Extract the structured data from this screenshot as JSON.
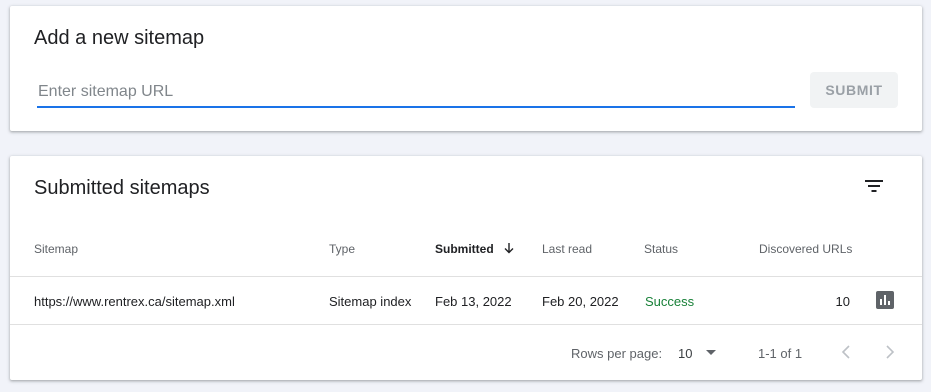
{
  "add_sitemap": {
    "title": "Add a new sitemap",
    "input_placeholder": "Enter sitemap URL",
    "input_value": "",
    "submit_label": "SUBMIT"
  },
  "submitted": {
    "title": "Submitted sitemaps",
    "columns": {
      "sitemap": "Sitemap",
      "type": "Type",
      "submitted": "Submitted",
      "last_read": "Last read",
      "status": "Status",
      "discovered": "Discovered URLs"
    },
    "rows": [
      {
        "sitemap": "https://www.rentrex.ca/sitemap.xml",
        "type": "Sitemap index",
        "submitted": "Feb 13, 2022",
        "last_read": "Feb 20, 2022",
        "status": "Success",
        "discovered": "10"
      }
    ],
    "pagination": {
      "rows_per_page_label": "Rows per page:",
      "rows_per_page_value": "10",
      "range": "1-1 of 1"
    }
  },
  "colors": {
    "accent": "#1a73e8",
    "success": "#188038",
    "background": "#f1f3f9"
  },
  "icons": [
    "filter-icon",
    "arrow-down-icon",
    "bar-chart-icon",
    "dropdown-arrow-icon",
    "chevron-left-icon",
    "chevron-right-icon"
  ]
}
